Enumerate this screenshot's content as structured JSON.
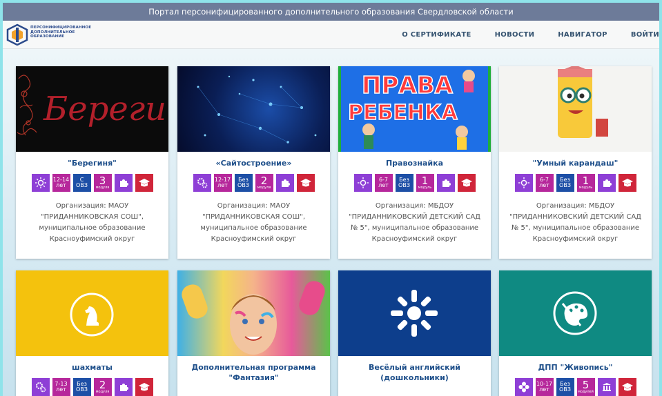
{
  "top_bar": {
    "title": "Портал персонифицированного дополнительного образования Свердловской области"
  },
  "logo": {
    "line1": "ПЕРСОНИФИЦИРОВАННОЕ",
    "line2": "ДОПОЛНИТЕЛЬНОЕ",
    "line3": "ОБРАЗОВАНИЕ"
  },
  "nav": {
    "items": [
      "О СЕРТИФИКАТЕ",
      "НОВОСТИ",
      "НАВИГАТОР",
      "ВОЙТИ"
    ]
  },
  "cards": [
    {
      "title": "\"Берегиня\"",
      "image_text": "Берегин",
      "age_top": "12-14",
      "age_bottom": "лет",
      "ovz_top": "С",
      "ovz_bottom": "ОВЗ",
      "modules": "3",
      "modules_label": "модуля",
      "org_line1": "Организация: МАОУ",
      "org_line2": "\"ПРИДАННИКОВСКАЯ СОШ\",",
      "org_line3": "муниципальное образование",
      "org_line4": "Красноуфимский округ"
    },
    {
      "title": "«Сайтостроение»",
      "age_top": "12-17",
      "age_bottom": "лет",
      "ovz_top": "Без",
      "ovz_bottom": "ОВЗ",
      "modules": "2",
      "modules_label": "модуля",
      "org_line1": "Организация: МАОУ",
      "org_line2": "\"ПРИДАННИКОВСКАЯ СОШ\",",
      "org_line3": "муниципальное образование",
      "org_line4": "Красноуфимский округ"
    },
    {
      "title": "Правознайка",
      "image_text1": "ПРАВА",
      "image_text2": "РЕБЕНКА",
      "age_top": "6-7",
      "age_bottom": "лет",
      "ovz_top": "Без",
      "ovz_bottom": "ОВЗ",
      "modules": "1",
      "modules_label": "модуль",
      "org_line1": "Организация: МБДОУ",
      "org_line2": "\"ПРИДАННИКОВСКИЙ ДЕТСКИЙ САД",
      "org_line3": "№ 5\", муниципальное образование",
      "org_line4": "Красноуфимский округ"
    },
    {
      "title": "\"Умный карандаш\"",
      "age_top": "6-7",
      "age_bottom": "лет",
      "ovz_top": "Без",
      "ovz_bottom": "ОВЗ",
      "modules": "1",
      "modules_label": "модуль",
      "org_line1": "Организация: МБДОУ",
      "org_line2": "\"ПРИДАННИКОВСКИЙ ДЕТСКИЙ САД",
      "org_line3": "№ 5\", муниципальное образование",
      "org_line4": "Красноуфимский округ"
    },
    {
      "title": "шахматы",
      "age_top": "7-13",
      "age_bottom": "лет",
      "ovz_top": "Без",
      "ovz_bottom": "ОВЗ",
      "modules": "2",
      "modules_label": "модуля"
    },
    {
      "title_line1": "Дополнительная программа",
      "title_line2": "\"Фантазия\""
    },
    {
      "title_line1": "Весёлый английский",
      "title_line2": "(дошкольники)"
    },
    {
      "title": "ДПП \"Живопись\"",
      "age_top": "10-17",
      "age_bottom": "лет",
      "ovz_top": "Без",
      "ovz_bottom": "ОВЗ",
      "modules": "5",
      "modules_label": "модулей"
    }
  ],
  "colors": {
    "purple": "#8e3fd6",
    "magenta": "#b6279b",
    "blue": "#1d4fa6",
    "red": "#d0253a",
    "chess_yellow": "#f4c20d",
    "english_blue": "#0d3e8c",
    "painting_teal": "#0f8a82"
  }
}
